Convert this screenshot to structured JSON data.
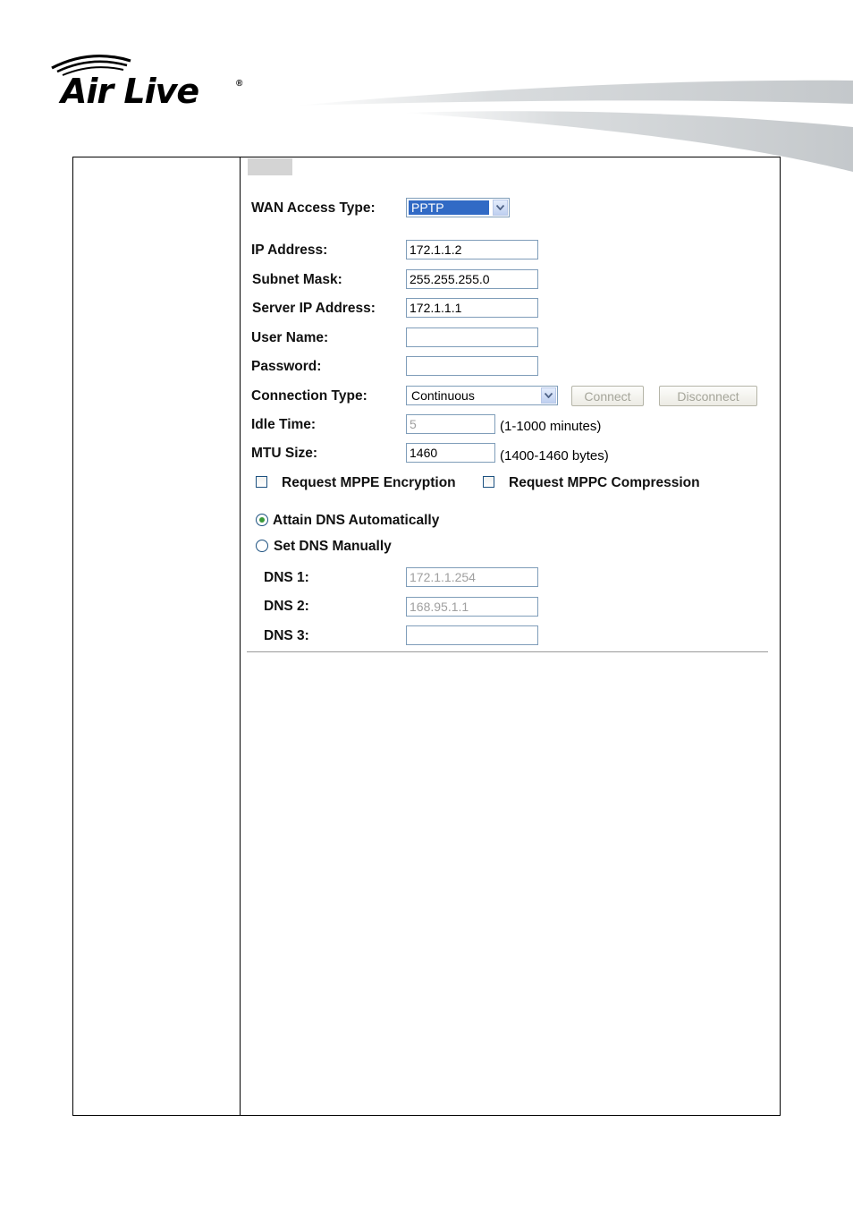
{
  "logo": {
    "text": "Air Live",
    "registered": "®"
  },
  "form": {
    "wan_access_type": {
      "label": "WAN Access Type:",
      "value": "PPTP"
    },
    "ip_address": {
      "label": "IP Address:",
      "value": "172.1.1.2"
    },
    "subnet_mask": {
      "label": "Subnet Mask:",
      "value": "255.255.255.0"
    },
    "server_ip": {
      "label": "Server IP Address:",
      "value": "172.1.1.1"
    },
    "user_name": {
      "label": "User Name:",
      "value": ""
    },
    "password": {
      "label": "Password:",
      "value": ""
    },
    "connection_type": {
      "label": "Connection Type:",
      "value": "Continuous",
      "connect_label": "Connect",
      "disconnect_label": "Disconnect"
    },
    "idle_time": {
      "label": "Idle Time:",
      "value": "5",
      "hint": "(1-1000 minutes)"
    },
    "mtu_size": {
      "label": "MTU Size:",
      "value": "1460",
      "hint": "(1400-1460 bytes)"
    },
    "mppe": {
      "label": "Request MPPE Encryption",
      "checked": false
    },
    "mppc": {
      "label": "Request MPPC Compression",
      "checked": false
    },
    "dns_mode": {
      "auto_label": "Attain DNS Automatically",
      "manual_label": "Set DNS Manually",
      "selected": "auto"
    },
    "dns1": {
      "label": "DNS 1:",
      "value": "172.1.1.254"
    },
    "dns2": {
      "label": "DNS 2:",
      "value": "168.95.1.1"
    },
    "dns3": {
      "label": "DNS 3:",
      "value": ""
    }
  },
  "colors": {
    "field_border": "#7f9db9",
    "selection": "#316ac5",
    "disabled_text": "#a0a0a0",
    "swoosh": "#cfd3d6"
  }
}
